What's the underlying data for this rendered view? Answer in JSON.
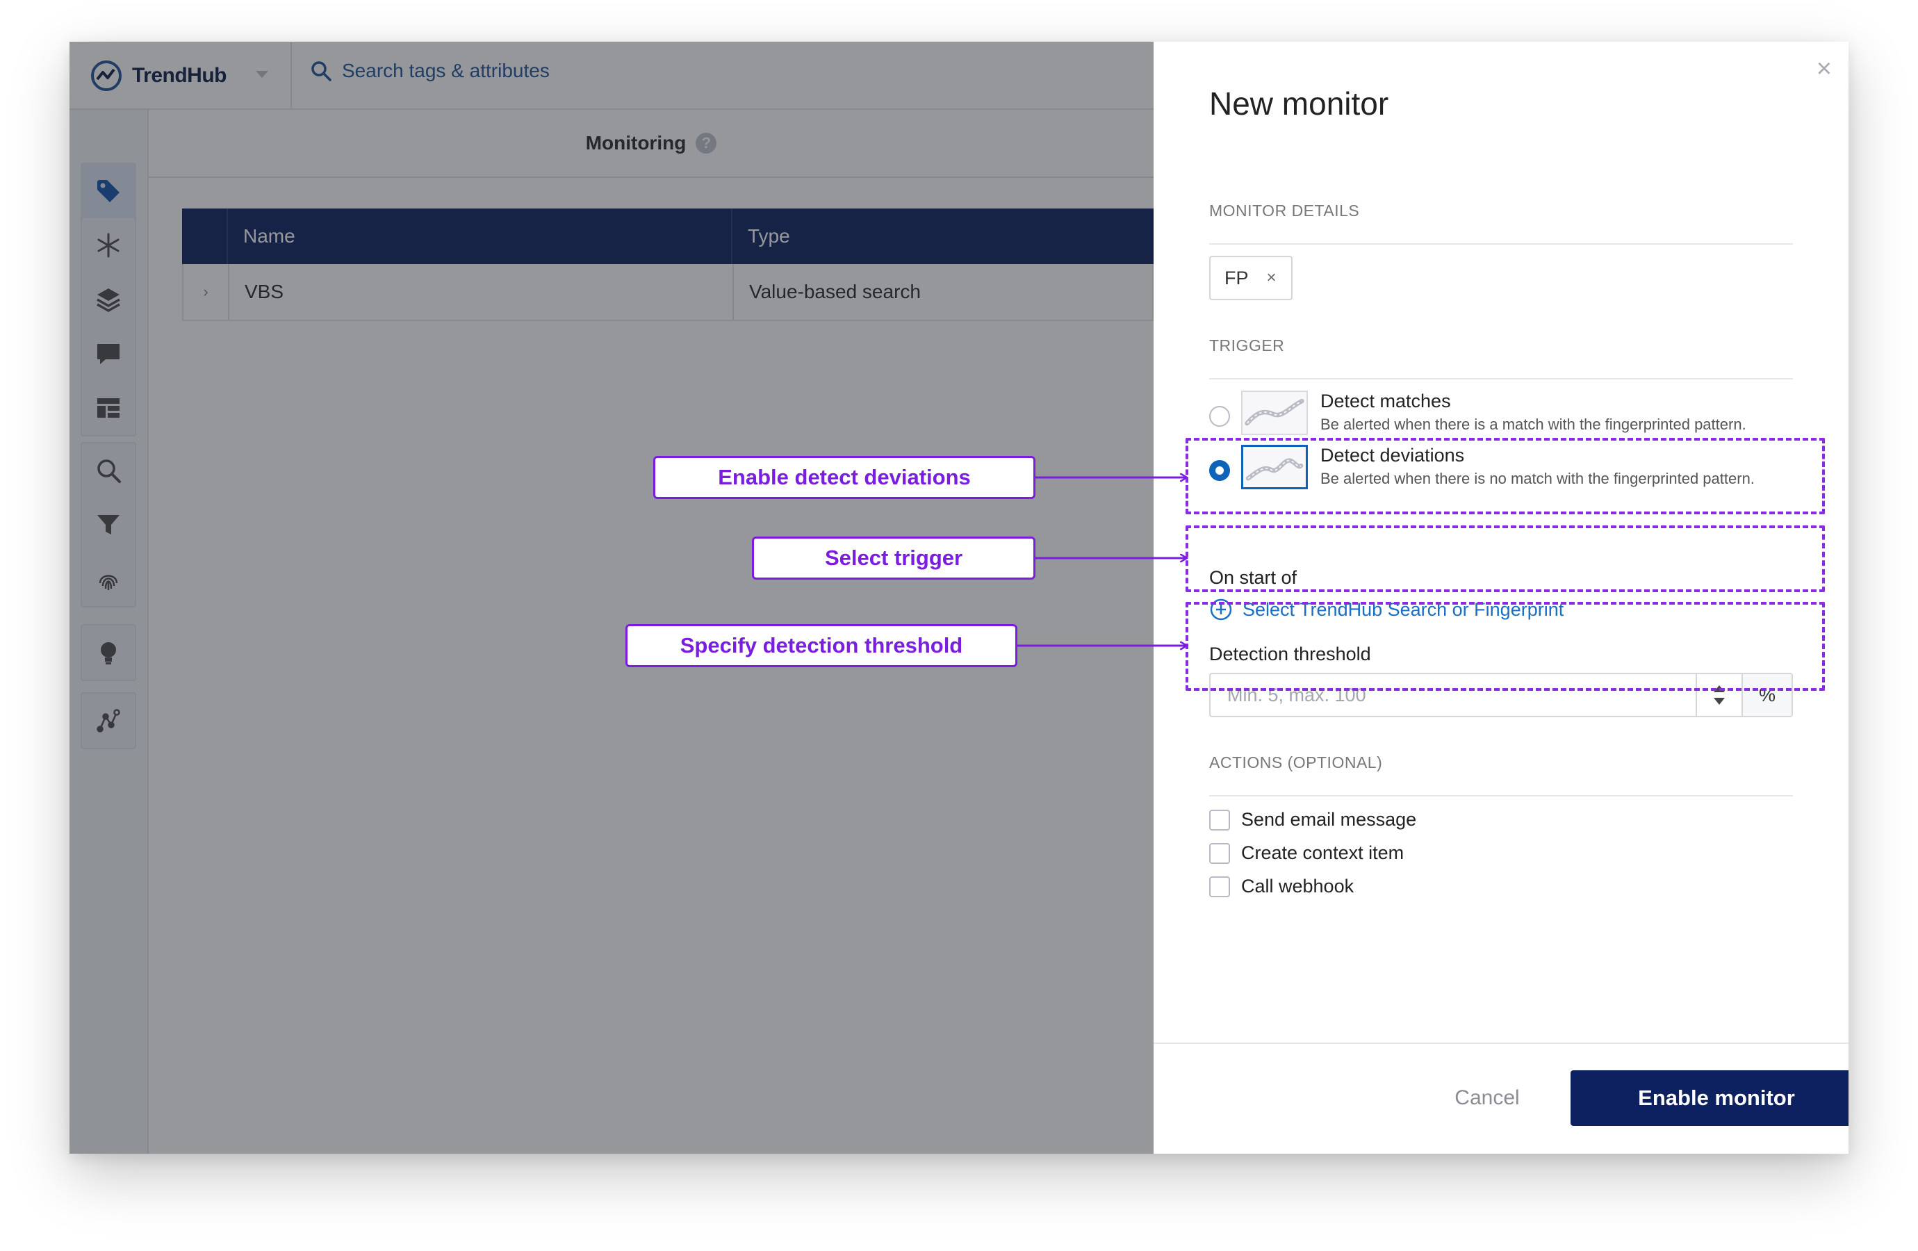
{
  "app": {
    "logo_text": "TrendHub",
    "search_placeholder": "Search tags & attributes",
    "page_title": "Monitoring",
    "help_label": "?",
    "sidebar_icons": [
      "tag-icon",
      "asterisk-icon",
      "layers-icon",
      "chat-icon",
      "dashboard-icon",
      "search-icon",
      "filter-icon",
      "fingerprint-icon",
      "lightbulb-icon",
      "graph-icon"
    ],
    "table": {
      "headers": [
        "Name",
        "Type"
      ],
      "rows": [
        {
          "expand": "›",
          "name": "VBS",
          "type": "Value-based search"
        }
      ]
    }
  },
  "drawer": {
    "title": "New monitor",
    "close": "×",
    "monitor_details_label": "MONITOR DETAILS",
    "chip": {
      "label": "FP",
      "remove": "×"
    },
    "trigger_label": "TRIGGER",
    "options": [
      {
        "title": "Detect matches",
        "description": "Be alerted when there is a match with the fingerprinted pattern.",
        "selected": false
      },
      {
        "title": "Detect deviations",
        "description": "Be alerted when there is no match with the fingerprinted pattern.",
        "selected": true
      }
    ],
    "on_start_label": "On start of",
    "select_link": "Select TrendHub Search or Fingerprint",
    "threshold_label": "Detection threshold",
    "threshold_placeholder": "Min. 5, max. 100",
    "threshold_unit": "%",
    "actions_label": "ACTIONS (OPTIONAL)",
    "actions": [
      "Send email message",
      "Create context item",
      "Call webhook"
    ],
    "cancel_label": "Cancel",
    "enable_label": "Enable monitor"
  },
  "annotations": {
    "enable_detect_deviations": "Enable detect deviations",
    "select_trigger": "Select trigger",
    "specify_detection_threshold": "Specify detection threshold"
  },
  "colors": {
    "primary_navy": "#0d2160",
    "table_header": "#1a2a66",
    "link_blue": "#1a6fc4",
    "radio_blue": "#0c63b8",
    "annotation_purple": "#7a1de0"
  }
}
